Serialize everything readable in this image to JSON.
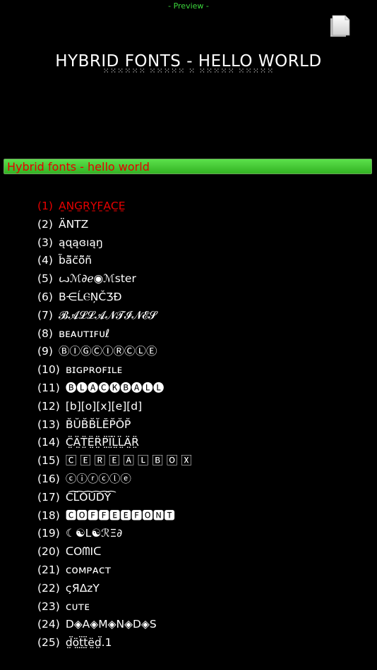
{
  "header": {
    "preview_label": "- Preview -"
  },
  "preview": {
    "text": "HYBRID FONTS - HELLO WORLD",
    "dots": "⁙⁙⁙⁙⁙⁙ ⁙⁙⁙⁙⁙ ⁙ ⁙⁙⁙⁙⁙ ⁙⁙⁙⁙⁙"
  },
  "input": {
    "value": "Hybrid fonts - hello world"
  },
  "fonts": [
    {
      "num": "(1)",
      "name": "A̱ṈG̱ṞY̱F̱A̱C̱E̱"
    },
    {
      "num": "(2)",
      "name": "ÄNTZ"
    },
    {
      "num": "(3)",
      "name": "ąɋąɞıąŋ"
    },
    {
      "num": "(4)",
      "name": "b̃ã̃c̃õ̃ñ"
    },
    {
      "num": "(5)",
      "name": "ꙍℳ∂ℯ◉ℳster"
    },
    {
      "num": "(6)",
      "name": "B⋲ĹⲈŅČƷÐ"
    },
    {
      "num": "(7)",
      "name": "𝓑𝓐𝓛𝓛𝓐𝓝𝓣𝓘𝓝𝓔𝓢"
    },
    {
      "num": "(8)",
      "name": "ʙᴇᴀᴜᴛɪꜰᴜℓ"
    },
    {
      "num": "(9)",
      "name": "ⒷⒾⒼⒸⒾⓇⒸⓁⒺ"
    },
    {
      "num": "(10)",
      "name": "ʙɪɢᴘʀᴏꜰɪʟᴇ"
    },
    {
      "num": "(11)",
      "name": "🅑🅛🅐🅒🅚🅑🅐🅛🅛"
    },
    {
      "num": "(12)",
      "name": "[b][o][x][e][d]"
    },
    {
      "num": "(13)",
      "name": "B̆ŬB̆B̆L̆ĔP̆ŎP̆"
    },
    {
      "num": "(14)",
      "name": "C̤̈Ä̤T̤̈Ë̤R̤̈P̤̈Ï̤L̤̈L̤̈Ä̤R̤̈"
    },
    {
      "num": "(15)",
      "name": "🄲 🄴 🅁 🄴 🄰 🄻 🄱 🄾 🅇"
    },
    {
      "num": "(16)",
      "name": "ⓒⓘⓡⓒⓛⓔ"
    },
    {
      "num": "(17)",
      "name": "C͡L͡O͡U͡D͡Y͡"
    },
    {
      "num": "(18)",
      "name": "🅲🅾🅵🅵🅴🅴🅵🅾🅽🆃"
    },
    {
      "num": "(19)",
      "name": "☾☯L☯ℛΞ∂"
    },
    {
      "num": "(20)",
      "name": "ᑕOᗰIᑕ"
    },
    {
      "num": "(21)",
      "name": "ᴄᴏᴍᴘᴀᴄᴛ"
    },
    {
      "num": "(22)",
      "name": "ςЯΔzΥ"
    },
    {
      "num": "(23)",
      "name": "ᴄᴜᴛᴇ"
    },
    {
      "num": "(24)",
      "name": "D◈A◈M◈N◈D◈S"
    },
    {
      "num": "(25)",
      "name": "d̤̈ö̤ẗ̤ẗ̤ë̤d̤̈.1"
    }
  ],
  "colors": {
    "selected": "#e60000",
    "accent": "#3cd63c",
    "bar": "#44c434"
  }
}
